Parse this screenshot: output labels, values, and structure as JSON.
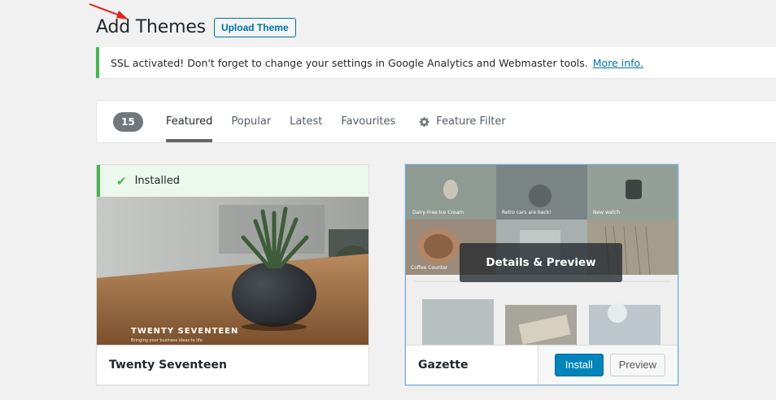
{
  "header": {
    "title": "Add Themes",
    "upload_label": "Upload Theme"
  },
  "notice": {
    "message": "SSL activated!  Don't forget to change your settings in Google Analytics and Webmaster tools.",
    "link_label": "More info."
  },
  "filter_bar": {
    "count": "15",
    "tabs": [
      {
        "label": "Featured",
        "active": true
      },
      {
        "label": "Popular",
        "active": false
      },
      {
        "label": "Latest",
        "active": false
      },
      {
        "label": "Favourites",
        "active": false
      }
    ],
    "feature_filter_label": "Feature Filter"
  },
  "themes": [
    {
      "name": "Twenty Seventeen",
      "installed_label": "Installed",
      "screenshot_title": "TWENTY SEVENTEEN",
      "screenshot_tagline": "Bringing your business ideas to life"
    },
    {
      "name": "Gazette",
      "overlay_label": "Details & Preview",
      "install_label": "Install",
      "preview_label": "Preview",
      "tiles": [
        "Dairy-Free Ice Cream",
        "Retro cars are back!",
        "New watch",
        "Coffee Counter"
      ]
    }
  ],
  "colors": {
    "accent": "#0073aa",
    "success": "#46b450",
    "annotation": "#e02020"
  }
}
